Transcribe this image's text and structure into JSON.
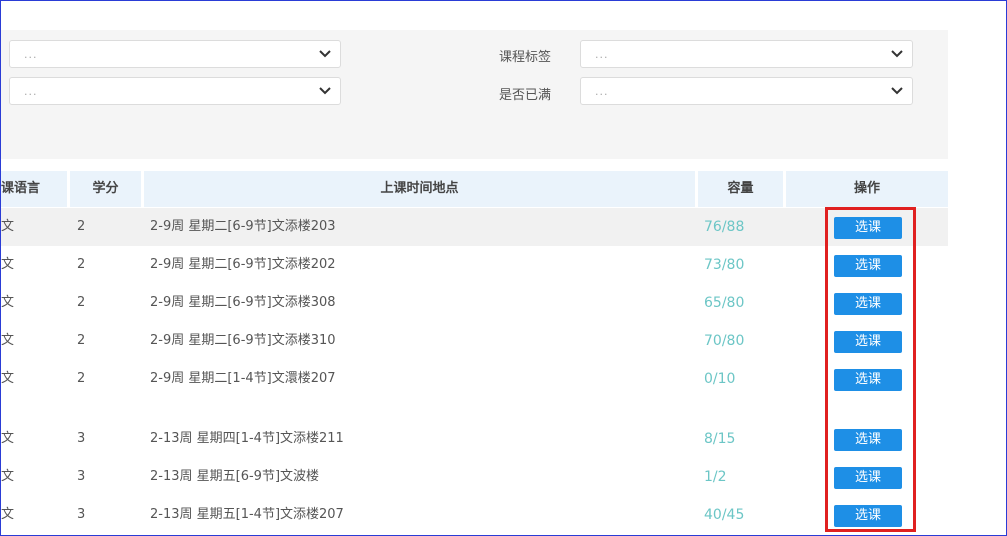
{
  "filters": {
    "row1_placeholder_left": "...",
    "row1_placeholder_right": "...",
    "row2_placeholder_left": "...",
    "row2_placeholder_right": "...",
    "course_tag_label": "课程标签",
    "is_full_label": "是否已满"
  },
  "table": {
    "headers": {
      "language": "课语言",
      "credits": "学分",
      "time_location": "上课时间地点",
      "capacity": "容量",
      "action": "操作"
    },
    "rows": [
      {
        "lang": "文",
        "credits": "2",
        "time": "2-9周 星期二[6-9节]文添楼203",
        "capacity": "76/88",
        "action": "选课"
      },
      {
        "lang": "文",
        "credits": "2",
        "time": "2-9周 星期二[6-9节]文添楼202",
        "capacity": "73/80",
        "action": "选课"
      },
      {
        "lang": "文",
        "credits": "2",
        "time": "2-9周 星期二[6-9节]文添楼308",
        "capacity": "65/80",
        "action": "选课"
      },
      {
        "lang": "文",
        "credits": "2",
        "time": "2-9周 星期二[6-9节]文添楼310",
        "capacity": "70/80",
        "action": "选课"
      },
      {
        "lang": "文",
        "credits": "2",
        "time": "2-9周 星期二[1-4节]文澴楼207",
        "capacity": "0/10",
        "action": "选课"
      },
      {
        "lang": "文",
        "credits": "3",
        "time": "2-13周 星期四[1-4节]文添楼211",
        "capacity": "8/15",
        "action": "选课"
      },
      {
        "lang": "文",
        "credits": "3",
        "time": "2-13周 星期五[6-9节]文波楼",
        "capacity": "1/2",
        "action": "选课"
      },
      {
        "lang": "文",
        "credits": "3",
        "time": "2-13周 星期五[1-4节]文添楼207",
        "capacity": "40/45",
        "action": "选课"
      }
    ]
  },
  "colors": {
    "button": "#1e8fe6",
    "capacity_text": "#6cc6c6",
    "header_bg": "#eaf3fb",
    "highlight_border": "#e02020"
  }
}
